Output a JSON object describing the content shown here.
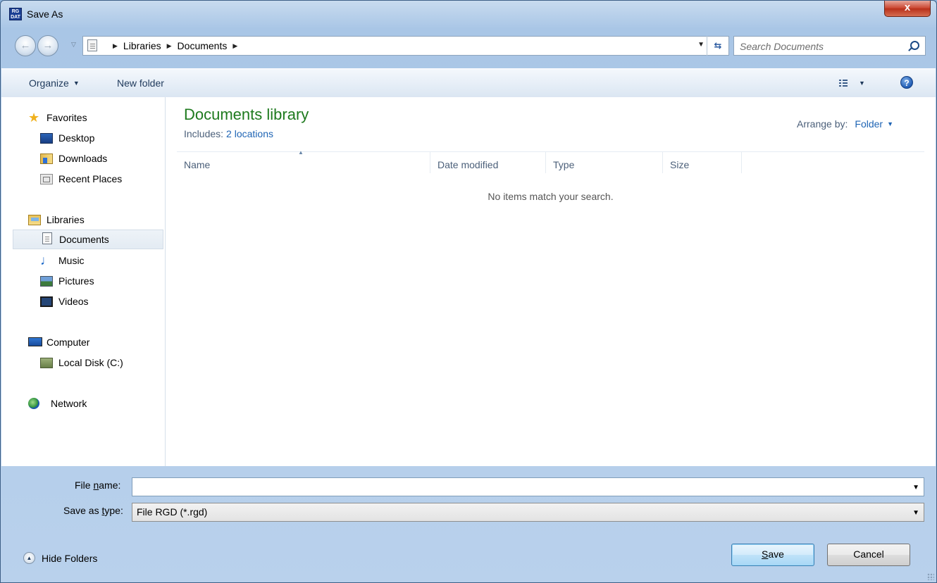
{
  "window": {
    "title": "Save As",
    "app_icon_text": "RG DAT",
    "close_label": "x"
  },
  "nav": {
    "back_icon": "back-arrow-icon",
    "forward_icon": "forward-arrow-icon",
    "address_crumbs": [
      "Libraries",
      "Documents"
    ],
    "search_placeholder": "Search Documents"
  },
  "toolbar": {
    "organize_label": "Organize",
    "new_folder_label": "New folder"
  },
  "sidebar": {
    "items": [
      {
        "label": "Favorites",
        "icon": "star-icon"
      },
      {
        "label": "Desktop",
        "icon": "desktop-icon"
      },
      {
        "label": "Downloads",
        "icon": "downloads-icon"
      },
      {
        "label": "Recent Places",
        "icon": "recent-places-icon"
      },
      {
        "label": "Libraries",
        "icon": "libraries-icon"
      },
      {
        "label": "Documents",
        "icon": "document-icon",
        "selected": true
      },
      {
        "label": "Music",
        "icon": "music-icon"
      },
      {
        "label": "Pictures",
        "icon": "pictures-icon"
      },
      {
        "label": "Videos",
        "icon": "videos-icon"
      },
      {
        "label": "Computer",
        "icon": "computer-icon"
      },
      {
        "label": "Local Disk (C:)",
        "icon": "local-disk-icon"
      },
      {
        "label": "Network",
        "icon": "network-icon"
      }
    ]
  },
  "content": {
    "library_title": "Documents library",
    "includes_label": "Includes:",
    "includes_link": "2 locations",
    "arrange_label": "Arrange by:",
    "arrange_value": "Folder",
    "columns": [
      "Name",
      "Date modified",
      "Type",
      "Size"
    ],
    "empty_message": "No items match your search."
  },
  "footer": {
    "file_name_label_pre": "File ",
    "file_name_label_u": "n",
    "file_name_label_post": "ame:",
    "file_name_value": "",
    "save_type_label_pre": "Save as ",
    "save_type_label_u": "t",
    "save_type_label_post": "ype:",
    "save_type_value": "File RGD (*.rgd)",
    "hide_folders_label": "Hide Folders",
    "save_button_u": "S",
    "save_button_rest": "ave",
    "cancel_button": "Cancel"
  },
  "colors": {
    "library_title": "#1e7a1e",
    "link": "#1e64b4",
    "close_button": "#c9422c"
  }
}
